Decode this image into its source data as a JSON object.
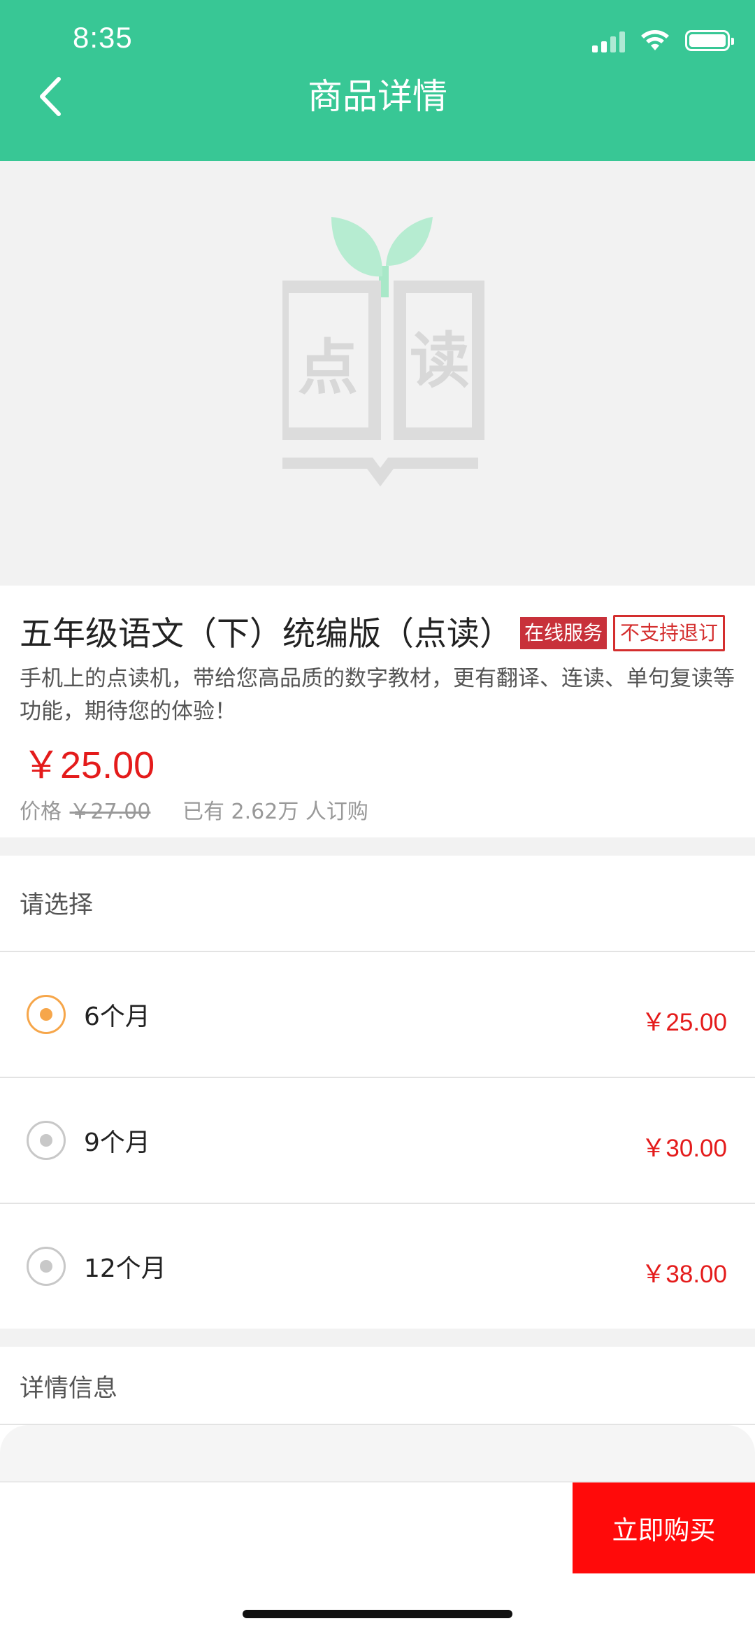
{
  "status_bar": {
    "time": "8:35"
  },
  "nav": {
    "title": "商品详情",
    "back_icon": "chevron-left-icon"
  },
  "banner": {
    "logo_chars": [
      "点",
      "读"
    ],
    "logo_icon": "book-sprout-logo"
  },
  "product": {
    "title": "五年级语文（下）统编版（点读）",
    "tag_online": "在线服务",
    "tag_refund": "不支持退订",
    "description": "手机上的点读机，带给您高品质的数字教材，更有翻译、连读、单句复读等功能，期待您的体验！",
    "price": "￥25.00",
    "price_label": "价格",
    "original_price": "￥27.00",
    "sold_text": "已有 2.62万 人订购"
  },
  "selection": {
    "header": "请选择",
    "options": [
      {
        "label": "6个月",
        "price": "￥25.00",
        "selected": true
      },
      {
        "label": "9个月",
        "price": "￥30.00",
        "selected": false
      },
      {
        "label": "12个月",
        "price": "￥38.00",
        "selected": false
      }
    ]
  },
  "details": {
    "header": "详情信息"
  },
  "footer": {
    "buy_label": "立即购买"
  },
  "colors": {
    "brand": "#38c795",
    "price": "#e41b1b",
    "buy": "#ff0a0a",
    "radio_selected": "#f6a64a"
  }
}
